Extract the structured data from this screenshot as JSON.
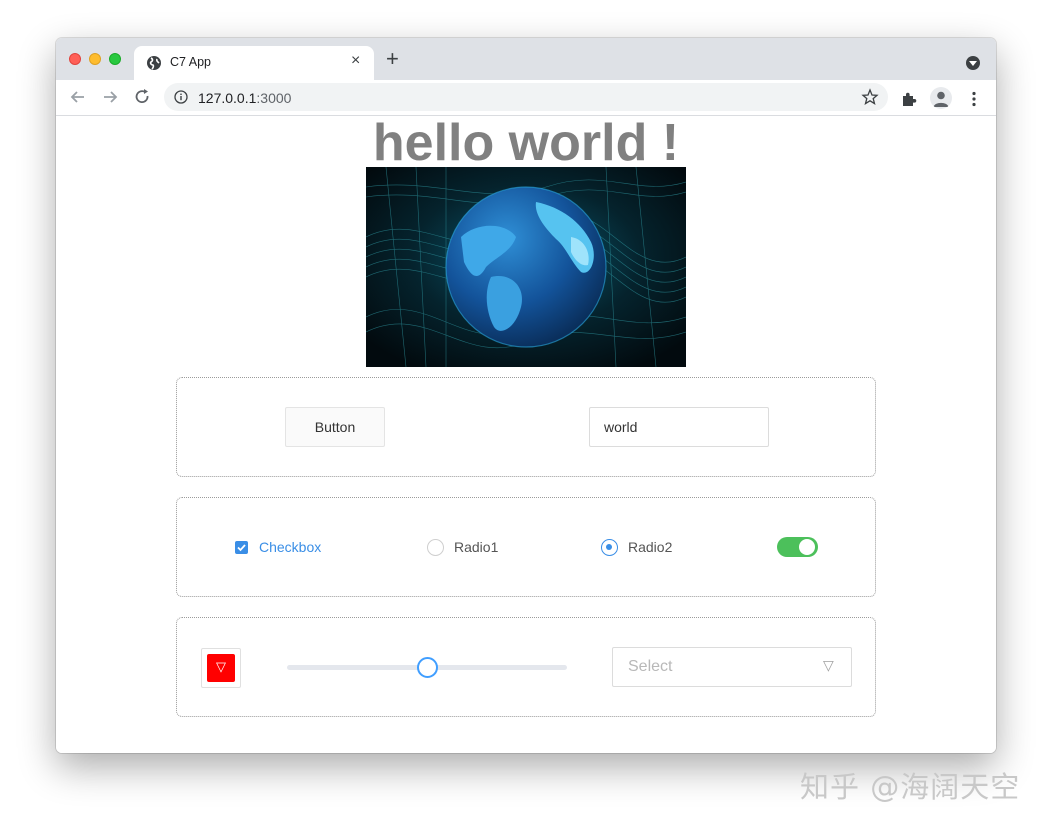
{
  "browser": {
    "tab_title": "C7 App",
    "tab_close_glyph": "×",
    "new_tab_glyph": "+",
    "url_host": "127.0.0.1",
    "url_port": ":3000"
  },
  "page": {
    "title": "hello world !",
    "hero_image": "globe-illustration",
    "button_label": "Button",
    "input_value": "world",
    "checkbox": {
      "label": "Checkbox",
      "checked": true
    },
    "radio1": {
      "label": "Radio1",
      "selected": false
    },
    "radio2": {
      "label": "Radio2",
      "selected": true
    },
    "switch": {
      "on": true,
      "color": "#4cc05b"
    },
    "color_picker": {
      "value": "#ff0000",
      "caret": "▽"
    },
    "slider": {
      "value": 50,
      "min": 0,
      "max": 100
    },
    "select": {
      "placeholder": "Select",
      "caret": "▽"
    },
    "accent_color": "#3a8ee6"
  },
  "watermark": "知乎 @海阔天空"
}
